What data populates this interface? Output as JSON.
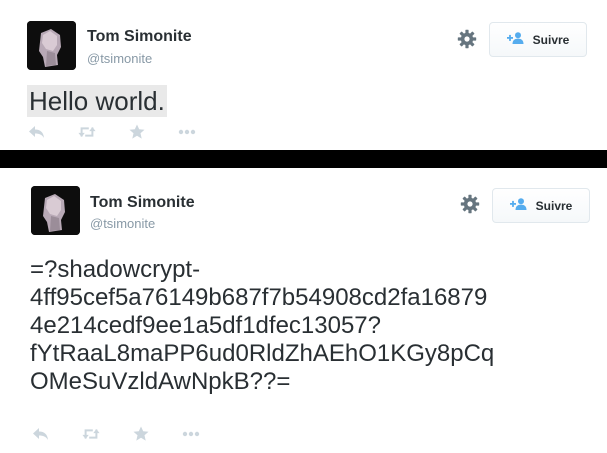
{
  "tweets": [
    {
      "author": {
        "name": "Tom Simonite",
        "handle": "@tsimonite"
      },
      "follow_label": "Suivre",
      "text": "Hello world."
    },
    {
      "author": {
        "name": "Tom Simonite",
        "handle": "@tsimonite"
      },
      "follow_label": "Suivre",
      "text_lines": [
        "=?shadowcrypt-",
        "4ff95cef5a76149b687f7b54908cd2fa16879",
        "4e214cedf9ee1a5df1dfec13057?",
        "fYtRaaL8maPP6ud0RldZhAEhO1KGy8pCq",
        "OMeSuVzldAwNpkB??="
      ]
    }
  ],
  "icons": [
    "gear-icon",
    "add-user-icon",
    "reply-icon",
    "retweet-icon",
    "favorite-icon",
    "more-icon"
  ],
  "colors": {
    "text": "#292f33",
    "muted": "#8899a6",
    "accent": "#55acee",
    "icon": "#ccd6dd",
    "divider": "#000000"
  }
}
